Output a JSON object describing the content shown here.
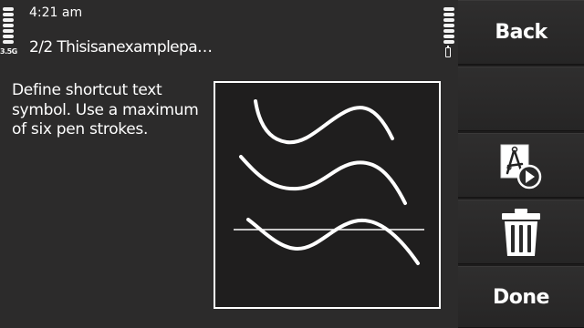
{
  "status_bar": {
    "time": "4:21 am",
    "network": "3.5G"
  },
  "header": {
    "title": "2/2 Thisisanexamplepa…"
  },
  "main": {
    "instructions": "Define shortcut text symbol. Use a maximum of six pen strokes."
  },
  "softkeys": {
    "back_label": "Back",
    "done_label": "Done"
  },
  "icons": {
    "signal": "signal-strength-icon",
    "battery": "battery-icon",
    "play": "playback-stroke-icon",
    "delete": "trash-icon"
  },
  "colors": {
    "background": "#2c2b2b",
    "panel": "#1d1c1c",
    "text": "#ffffff",
    "stroke": "#ffffff"
  }
}
